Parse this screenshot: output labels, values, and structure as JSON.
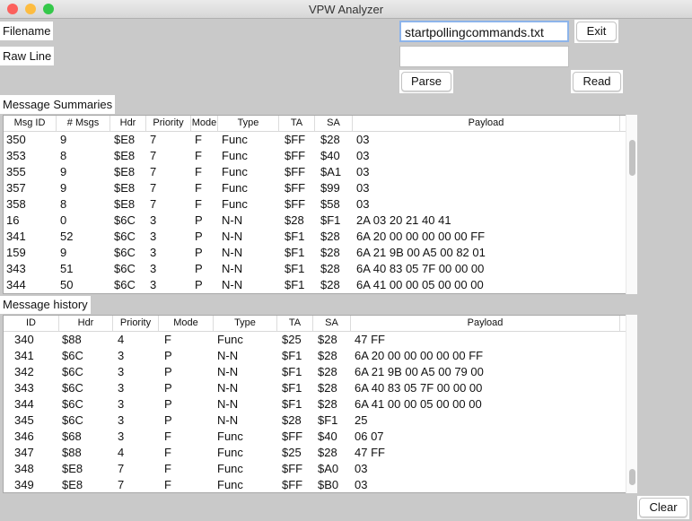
{
  "window": {
    "title": "VPW Analyzer"
  },
  "form": {
    "filename_label": "Filename",
    "filename_value": "startpollingcommands.txt",
    "raw_line_label": "Raw Line",
    "raw_line_value": "",
    "exit_label": "Exit",
    "parse_label": "Parse",
    "read_label": "Read",
    "clear_label": "Clear"
  },
  "summaries": {
    "title": "Message Summaries",
    "columns": [
      "Msg ID",
      "# Msgs",
      "Hdr",
      "Priority",
      "Mode",
      "Type",
      "TA",
      "SA",
      "Payload"
    ],
    "rows": [
      [
        "350",
        "9",
        "$E8",
        "7",
        "F",
        "Func",
        "$FF",
        "$28",
        "03"
      ],
      [
        "353",
        "8",
        "$E8",
        "7",
        "F",
        "Func",
        "$FF",
        "$40",
        "03"
      ],
      [
        "355",
        "9",
        "$E8",
        "7",
        "F",
        "Func",
        "$FF",
        "$A1",
        "03"
      ],
      [
        "357",
        "9",
        "$E8",
        "7",
        "F",
        "Func",
        "$FF",
        "$99",
        "03"
      ],
      [
        "358",
        "8",
        "$E8",
        "7",
        "F",
        "Func",
        "$FF",
        "$58",
        "03"
      ],
      [
        "16",
        "0",
        "$6C",
        "3",
        "P",
        "N-N",
        "$28",
        "$F1",
        "2A 03 20 21 40 41"
      ],
      [
        "341",
        "52",
        "$6C",
        "3",
        "P",
        "N-N",
        "$F1",
        "$28",
        "6A 20 00 00 00 00 00 FF"
      ],
      [
        "159",
        "9",
        "$6C",
        "3",
        "P",
        "N-N",
        "$F1",
        "$28",
        "6A 21 9B 00 A5 00 82 01"
      ],
      [
        "343",
        "51",
        "$6C",
        "3",
        "P",
        "N-N",
        "$F1",
        "$28",
        "6A 40 83 05 7F 00 00 00"
      ],
      [
        "344",
        "50",
        "$6C",
        "3",
        "P",
        "N-N",
        "$F1",
        "$28",
        "6A 41 00 00 05 00 00 00"
      ]
    ]
  },
  "history": {
    "title": "Message history",
    "columns": [
      "ID",
      "Hdr",
      "Priority",
      "Mode",
      "Type",
      "TA",
      "SA",
      "Payload"
    ],
    "rows": [
      [
        "340",
        "$88",
        "4",
        "F",
        "Func",
        "$25",
        "$28",
        "47 FF"
      ],
      [
        "341",
        "$6C",
        "3",
        "P",
        "N-N",
        "$F1",
        "$28",
        "6A 20 00 00 00 00 00 FF"
      ],
      [
        "342",
        "$6C",
        "3",
        "P",
        "N-N",
        "$F1",
        "$28",
        "6A 21 9B 00 A5 00 79 00"
      ],
      [
        "343",
        "$6C",
        "3",
        "P",
        "N-N",
        "$F1",
        "$28",
        "6A 40 83 05 7F 00 00 00"
      ],
      [
        "344",
        "$6C",
        "3",
        "P",
        "N-N",
        "$F1",
        "$28",
        "6A 41 00 00 05 00 00 00"
      ],
      [
        "345",
        "$6C",
        "3",
        "P",
        "N-N",
        "$28",
        "$F1",
        "25"
      ],
      [
        "346",
        "$68",
        "3",
        "F",
        "Func",
        "$FF",
        "$40",
        "06 07"
      ],
      [
        "347",
        "$88",
        "4",
        "F",
        "Func",
        "$25",
        "$28",
        "47 FF"
      ],
      [
        "348",
        "$E8",
        "7",
        "F",
        "Func",
        "$FF",
        "$A0",
        "03"
      ],
      [
        "349",
        "$E8",
        "7",
        "F",
        "Func",
        "$FF",
        "$B0",
        "03"
      ]
    ]
  },
  "colors": {
    "close": "#fc605c",
    "minimize": "#fdbc40",
    "zoom": "#34c84a",
    "focus": "#8db4ea"
  }
}
